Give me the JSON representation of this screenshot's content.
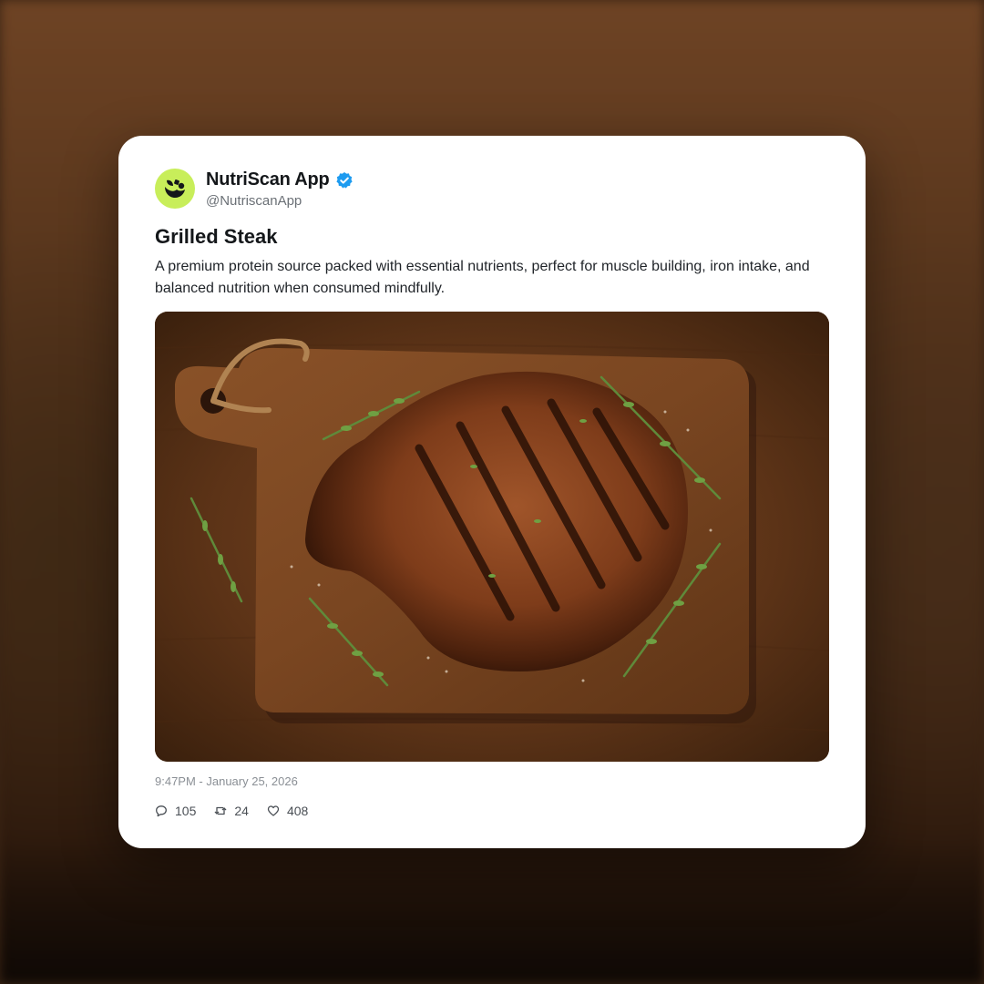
{
  "post": {
    "author_name": "NutriScan App",
    "author_handle": "@NutriscanApp",
    "verified": true,
    "title": "Grilled Steak",
    "description": "A premium protein source packed with essential nutrients, perfect for muscle building, iron intake, and balanced nutrition when consumed mindfully.",
    "timestamp": "9:47PM - January 25, 2026",
    "image_icon": "grilled-steak-on-cutting-board",
    "stats": {
      "replies": "105",
      "reposts": "24",
      "likes": "408"
    }
  },
  "colors": {
    "avatar_bg": "#c8ee5a",
    "verified_badge": "#1d9bf0",
    "card_bg": "#ffffff",
    "title_text": "#14171a"
  }
}
